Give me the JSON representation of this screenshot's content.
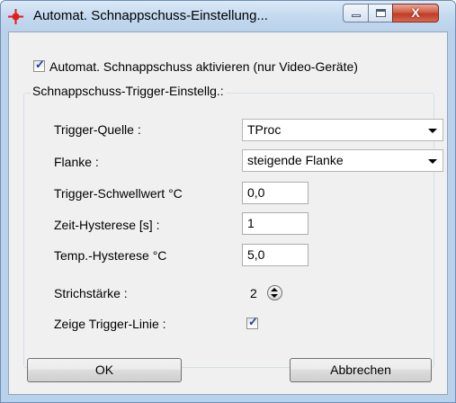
{
  "window": {
    "title": "Automat. Schnappschuss-Einstellung...",
    "icon": "crosshair-target-icon",
    "controls": {
      "minimize": "minimize-icon",
      "maximize": "maximize-icon",
      "close": "X"
    }
  },
  "enable_checkbox": {
    "label": "Automat. Schnappschuss aktivieren (nur Video-Geräte)",
    "checked": true
  },
  "group": {
    "title": "Schnappschuss-Trigger-Einstellg.:",
    "trigger_source": {
      "label": "Trigger-Quelle :",
      "value": "TProc"
    },
    "edge": {
      "label": "Flanke :",
      "value": "steigende Flanke"
    },
    "threshold": {
      "label": "Trigger-Schwellwert °C",
      "value": "0,0"
    },
    "time_hysteresis": {
      "label": "Zeit-Hysterese [s] :",
      "value": "1"
    },
    "temp_hysteresis": {
      "label": "Temp.-Hysterese °C",
      "value": "5,0"
    },
    "line_width": {
      "label": "Strichstärke :",
      "value": "2"
    },
    "show_trigger_line": {
      "label": "Zeige Trigger-Linie :",
      "checked": true
    }
  },
  "buttons": {
    "ok": "OK",
    "cancel": "Abbrechen"
  },
  "colors": {
    "titlebar": "#c4d9ef",
    "close_button": "#c03a24",
    "dialog_bg": "#f0f0f0",
    "checkmark": "#1f3f9e"
  }
}
